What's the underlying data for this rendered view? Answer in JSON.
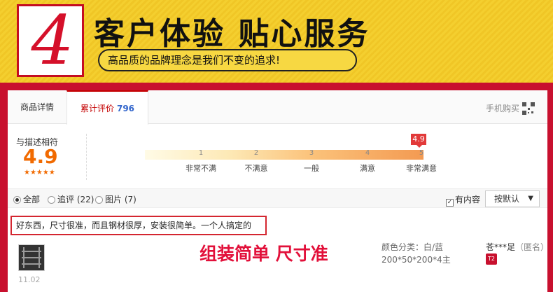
{
  "banner": {
    "number": "4",
    "title": "客户体验 贴心服务",
    "subtitle": "高品质的品牌理念是我们不变的追求!"
  },
  "tabs": {
    "details": "商品详情",
    "reviews": "累计评价",
    "review_count": "796",
    "mobile_buy": "手机购买"
  },
  "score": {
    "label": "与描述相符",
    "value": "4.9",
    "stars": "★★★★★",
    "flag": "4.9",
    "ticks": [
      "1",
      "2",
      "3",
      "4",
      "5"
    ],
    "labels": [
      "非常不满",
      "不满意",
      "一般",
      "满意",
      "非常满意"
    ]
  },
  "filters": {
    "all": "全部",
    "followup": "追评 (22)",
    "images": "图片 (7)",
    "has_content": "有内容",
    "sort": "按默认"
  },
  "review": {
    "text": "好东西，尺寸很准，而且钢材很厚，安装很简单。一个人搞定的",
    "promo": "组装简单 尺寸准",
    "sku_label": "颜色分类：白/蓝",
    "sku_size": "200*50*200*4主",
    "user": "苍***足",
    "anon": "（匿名）",
    "badge": "T2",
    "date": "11.02"
  },
  "colors": {
    "brand_red": "#c8102e",
    "banner_yellow": "#f4cf2f",
    "score_orange": "#f16a00",
    "promo_red": "#e2103a"
  }
}
